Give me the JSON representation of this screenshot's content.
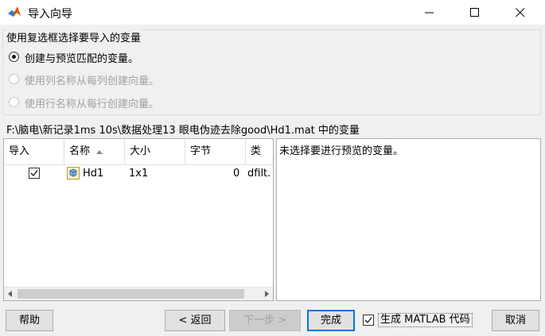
{
  "window": {
    "title": "导入向导"
  },
  "options_group": {
    "title": "使用复选框选择要导入的变量",
    "radios": [
      {
        "label": "创建与预览匹配的变量。",
        "selected": true,
        "enabled": true
      },
      {
        "label": "使用列名称从每列创建向量。",
        "selected": false,
        "enabled": false
      },
      {
        "label": "使用行名称从每行创建向量。",
        "selected": false,
        "enabled": false
      }
    ]
  },
  "path_label": "F:\\脑电\\新记录1ms 10s\\数据处理13 眼电伪迹去除good\\Hd1.mat 中的变量",
  "table": {
    "headers": {
      "import": "导入",
      "name": "名称",
      "size": "大小",
      "bytes": "字节",
      "class": "类"
    },
    "rows": [
      {
        "checked": true,
        "name": "Hd1",
        "size": "1x1",
        "bytes": "0",
        "class": "dfilt."
      }
    ]
  },
  "preview": {
    "text": "未选择要进行预览的变量。"
  },
  "buttons": {
    "help": "帮助",
    "back": "< 返回",
    "next": "下一步 >",
    "finish": "完成",
    "cancel": "取消"
  },
  "generate_code": {
    "label": "生成 MATLAB 代码",
    "checked": true
  },
  "colors": {
    "accent": "#0078d7",
    "matlab_icon": "#e05a00"
  }
}
